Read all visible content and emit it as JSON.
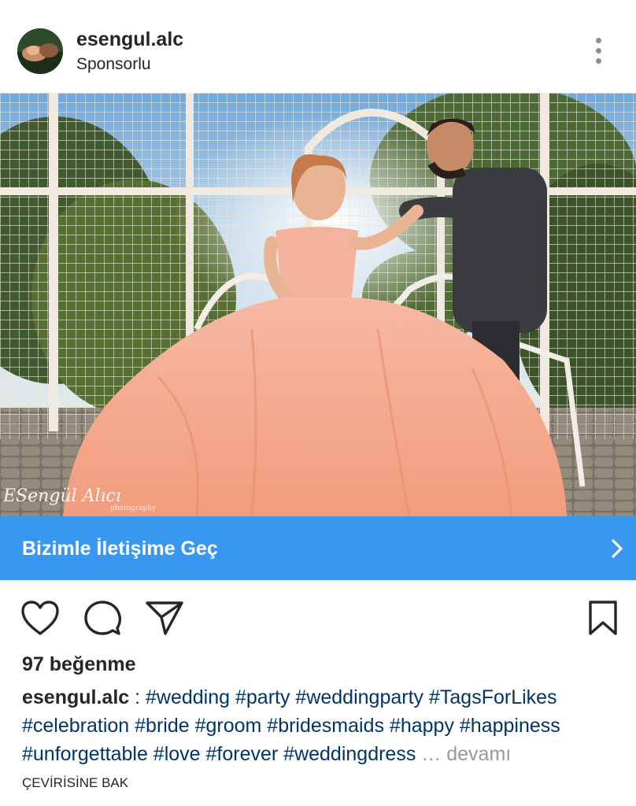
{
  "post": {
    "username": "esengul.alc",
    "sponsored_label": "Sponsorlu",
    "photo_watermark": "ESengül Alıcı",
    "photo_watermark_sub": "photography",
    "cta_label": "Bizimle İletişime Geç",
    "likes": "97 beğenme",
    "caption_user": "esengul.alc",
    "caption_separator": " : ",
    "caption_hashtags": "#wedding #party #weddingparty #TagsForLikes #celebration #bride #groom #bridesmaids #happy #happiness #unforgettable #love #forever #weddingdress",
    "caption_more": " … devamı",
    "translate_label": "ÇEVİRİSİNE BAK"
  },
  "icons": {
    "avatar": "avatar",
    "more": "more-vertical-icon",
    "cta_chevron": "chevron-right-icon",
    "like": "heart-icon",
    "comment": "comment-icon",
    "share": "paper-plane-icon",
    "save": "bookmark-icon"
  },
  "colors": {
    "cta_background": "#3897f0",
    "hashtag": "#003569",
    "muted": "#999999",
    "text": "#262626"
  }
}
